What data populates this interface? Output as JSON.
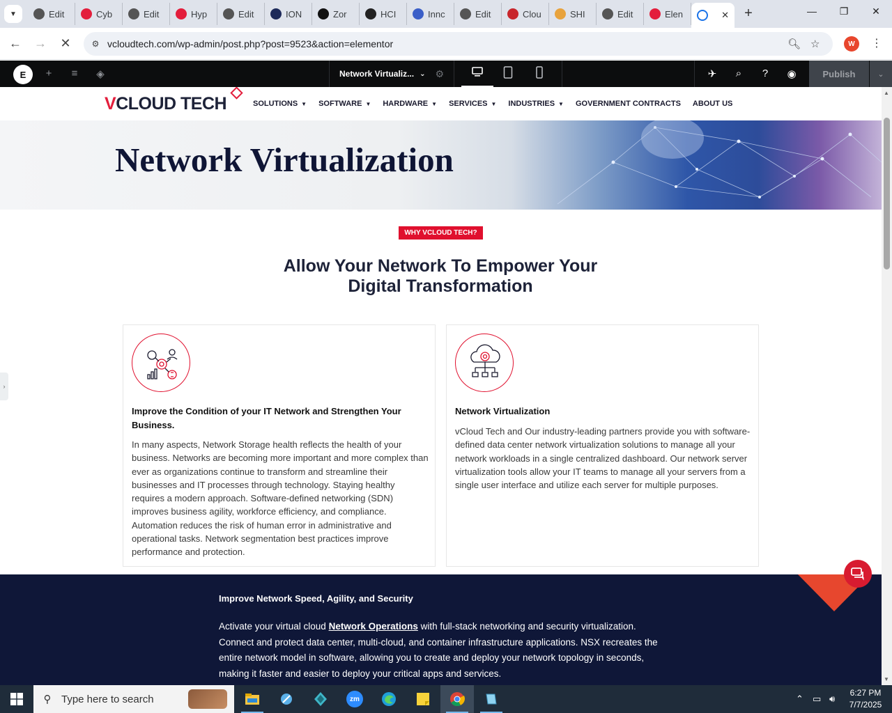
{
  "browser": {
    "tabs": [
      {
        "label": "Edit",
        "favicon": "wordpress-icon",
        "color": "#555"
      },
      {
        "label": "Cyb",
        "favicon": "vcloud-icon",
        "color": "#e31e3c"
      },
      {
        "label": "Edit",
        "favicon": "wordpress-icon",
        "color": "#555"
      },
      {
        "label": "Hyp",
        "favicon": "vcloud-icon",
        "color": "#e31e3c"
      },
      {
        "label": "Edit",
        "favicon": "wordpress-icon",
        "color": "#555"
      },
      {
        "label": "ION",
        "favicon": "ion-icon",
        "color": "#1d2a5a"
      },
      {
        "label": "Zor",
        "favicon": "zoro-icon",
        "color": "#111"
      },
      {
        "label": "HCI",
        "favicon": "openai-icon",
        "color": "#222"
      },
      {
        "label": "Innc",
        "favicon": "innovation-icon",
        "color": "#3b5fc8"
      },
      {
        "label": "Edit",
        "favicon": "wordpress-icon",
        "color": "#555"
      },
      {
        "label": "Clou",
        "favicon": "cloud-brand-icon",
        "color": "#c8262c"
      },
      {
        "label": "SHI",
        "favicon": "shi-icon",
        "color": "#e8a33d"
      },
      {
        "label": "Edit",
        "favicon": "wordpress-icon",
        "color": "#555"
      },
      {
        "label": "Elen",
        "favicon": "vcloud-icon",
        "color": "#e31e3c"
      }
    ],
    "active_tab": {
      "favicon": "loading-icon",
      "close": "✕"
    },
    "new_tab": "+",
    "window_controls": {
      "minimize": "—",
      "restore": "❐",
      "close": "✕"
    },
    "url": "vcloudtech.com/wp-admin/post.php?post=9523&action=elementor",
    "profile_initial": "W"
  },
  "elementor": {
    "document_title": "Network Virtualiz...",
    "publish_label": "Publish"
  },
  "site": {
    "logo": {
      "v": "V",
      "rest": "CLOUD TECH"
    },
    "nav": [
      {
        "label": "SOLUTIONS",
        "dropdown": true
      },
      {
        "label": "SOFTWARE",
        "dropdown": true
      },
      {
        "label": "HARDWARE",
        "dropdown": true
      },
      {
        "label": "SERVICES",
        "dropdown": true
      },
      {
        "label": "INDUSTRIES",
        "dropdown": true
      },
      {
        "label": "GOVERNMENT CONTRACTS",
        "dropdown": false
      },
      {
        "label": "ABOUT US",
        "dropdown": false
      }
    ],
    "hero_title": "Network Virtualization",
    "badge": "WHY VCLOUD TECH?",
    "headline_line1": "Allow Your Network To Empower Your",
    "headline_line2": "Digital Transformation",
    "cards": [
      {
        "title": "Improve the Condition of your IT Network and Strengthen Your Business.",
        "body": "In many aspects, Network Storage health reflects the health of your business. Networks are becoming more important and more complex than ever as organizations continue to transform and streamline their businesses and IT processes through technology. Staying healthy requires a modern approach. Software-defined networking (SDN) improves business agility, workforce efficiency, and compliance. Automation reduces the risk of human error in administrative and operational tasks. Network segmentation best practices improve performance and protection."
      },
      {
        "title": "Network Virtualization",
        "body": "vCloud Tech and Our industry-leading partners provide you with software-defined data center network virtualization solutions to manage all your network workloads in a single centralized dashboard. Our network server virtualization tools allow your IT teams to manage all your servers from a single user interface and utilize each server for multiple purposes."
      }
    ],
    "dark_section": {
      "title": "Improve Network Speed, Agility, and Security",
      "body_pre": " Activate your virtual cloud ",
      "body_link": "Network Operations",
      "body_post": " with full-stack networking and security virtualization. Connect and protect data center, multi-cloud, and container infrastructure applications. NSX recreates the entire network model in software, allowing you to create and deploy your network topology in seconds, making it faster and easier to deploy your critical apps and services."
    }
  },
  "taskbar": {
    "search_placeholder": "Type here to search",
    "time": "6:27 PM",
    "date": "7/7/2025"
  },
  "colors": {
    "accent": "#e0102e",
    "navy": "#0f1738",
    "elementor_bar": "#0c0d0e"
  }
}
